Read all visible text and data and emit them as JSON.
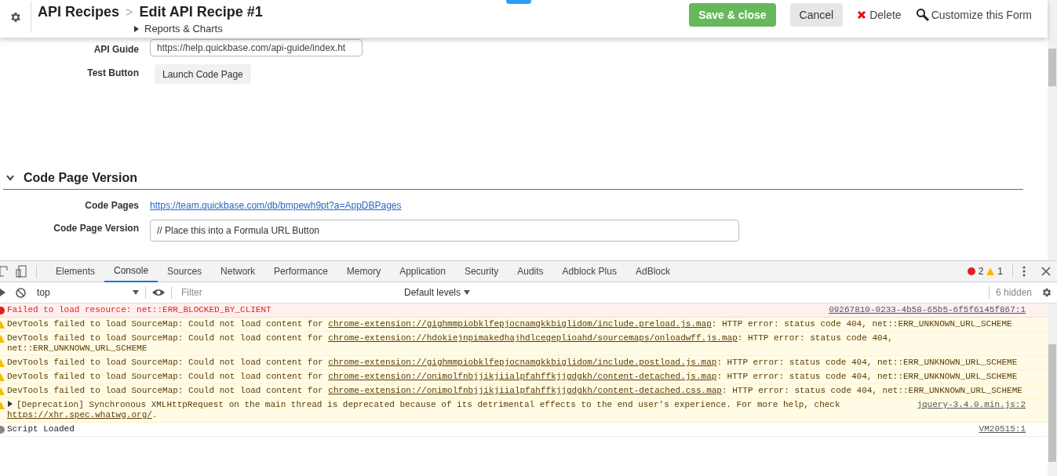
{
  "header": {
    "app": "API Recipes",
    "separator": ">",
    "title": "Edit API Recipe #1",
    "subnav": {
      "label": "Reports & Charts",
      "expanded": false
    },
    "buttons": [
      {
        "label": "Save & close",
        "kind": "primary"
      },
      {
        "label": "Cancel",
        "kind": "secondary"
      },
      {
        "label": "Delete",
        "kind": "delete"
      },
      {
        "label": "Customize this Form",
        "kind": "customize"
      }
    ]
  },
  "form_top": [
    {
      "label": "API Guide",
      "kind": "field",
      "value": "https://help.quickbase.com/api-guide/index.ht"
    },
    {
      "label": "Test Button",
      "kind": "button",
      "value": "Launch Code Page"
    }
  ],
  "section": {
    "title": "Code Page Version",
    "expanded": true,
    "rows": [
      {
        "label": "Code Pages",
        "kind": "link",
        "value": "https://team.quickbase.com/db/bmpewh9pt?a=AppDBPages"
      },
      {
        "label": "Code Page Version",
        "kind": "textarea",
        "value": "// Place this into a Formula URL Button"
      }
    ]
  },
  "devtools": {
    "tabs": [
      {
        "label": "Elements",
        "selected": false
      },
      {
        "label": "Console",
        "selected": true
      },
      {
        "label": "Sources",
        "selected": false
      },
      {
        "label": "Network",
        "selected": false
      },
      {
        "label": "Performance",
        "selected": false
      },
      {
        "label": "Memory",
        "selected": false
      },
      {
        "label": "Application",
        "selected": false
      },
      {
        "label": "Security",
        "selected": false
      },
      {
        "label": "Audits",
        "selected": false
      },
      {
        "label": "Adblock Plus",
        "selected": false
      },
      {
        "label": "AdBlock",
        "selected": false
      }
    ],
    "error_count": "2",
    "warning_count": "1",
    "context": "top",
    "filter_placeholder": "Filter",
    "levels": "Default levels",
    "hidden": "6 hidden",
    "messages": [
      {
        "kind": "error",
        "text": "Failed to load resource: net::ERR_BLOCKED_BY_CLIENT",
        "source": "09267810-0233-4b58-65b5-6f5f6145f867:1"
      },
      {
        "kind": "warning",
        "text": "DevTools failed to load SourceMap: Could not load content for ",
        "link": "chrome-extension://gighmmpiobklfepjocnamgkkbiglidom/include.preload.js.map",
        "after": ": HTTP error: status code 404, net::ERR_UNKNOWN_URL_SCHEME"
      },
      {
        "kind": "warning",
        "text": "DevTools failed to load SourceMap: Could not load content for ",
        "link": "chrome-extension://hdokiejnpimakedhajhdlcegeplioahd/sourcemaps/onloadwff.js.map",
        "after": ": HTTP error: status code 404, net::ERR_UNKNOWN_URL_SCHEME"
      },
      {
        "kind": "warning",
        "text": "DevTools failed to load SourceMap: Could not load content for ",
        "link": "chrome-extension://gighmmpiobklfepjocnamgkkbiglidom/include.postload.js.map",
        "after": ": HTTP error: status code 404, net::ERR_UNKNOWN_URL_SCHEME"
      },
      {
        "kind": "warning",
        "text": "DevTools failed to load SourceMap: Could not load content for ",
        "link": "chrome-extension://onimolfnbjjikjiialpfahffkjjgdgkh/content-detached.js.map",
        "after": ": HTTP error: status code 404, net::ERR_UNKNOWN_URL_SCHEME"
      },
      {
        "kind": "warning",
        "text": "DevTools failed to load SourceMap: Could not load content for ",
        "link": "chrome-extension://onimolfnbjjikjiialpfahffkjjgdgkh/content-detached.css.map",
        "after": ": HTTP error: status code 404, net::ERR_UNKNOWN_URL_SCHEME"
      },
      {
        "kind": "warning",
        "expanded": false,
        "text": "[Deprecation] Synchronous XMLHttpRequest on the main thread is deprecated because of its detrimental effects to the end user's experience. For more help, check ",
        "link": "https://xhr.spec.whatwg.org/",
        "after": ".",
        "source": "jquery-3.4.0.min.js:2"
      },
      {
        "kind": "info",
        "text": "Script Loaded",
        "source": "VM20515:1"
      }
    ]
  }
}
